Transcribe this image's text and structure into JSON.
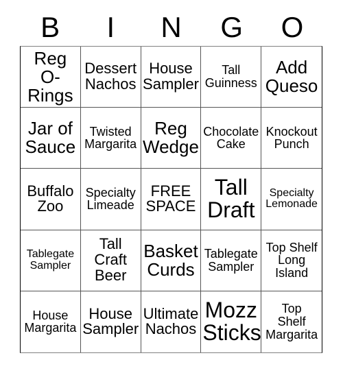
{
  "header": {
    "letters": [
      "B",
      "I",
      "N",
      "G",
      "O"
    ]
  },
  "grid": {
    "rows": 5,
    "columns": 5,
    "cells": [
      {
        "text": "Reg\nO-\nRings",
        "size": "lg"
      },
      {
        "text": "Dessert\nNachos",
        "size": "md"
      },
      {
        "text": "House\nSampler",
        "size": "md"
      },
      {
        "text": "Tall\nGuinness",
        "size": "sm"
      },
      {
        "text": "Add\nQueso",
        "size": "lg"
      },
      {
        "text": "Jar of\nSauce",
        "size": "lg"
      },
      {
        "text": "Twisted\nMargarita",
        "size": "sm"
      },
      {
        "text": "Reg\nWedge",
        "size": "lg"
      },
      {
        "text": "Chocolate\nCake",
        "size": "sm"
      },
      {
        "text": "Knockout\nPunch",
        "size": "sm"
      },
      {
        "text": "Buffalo\nZoo",
        "size": "md"
      },
      {
        "text": "Specialty\nLimeade",
        "size": "sm"
      },
      {
        "text": "FREE\nSPACE",
        "size": "md"
      },
      {
        "text": "Tall\nDraft",
        "size": "xl"
      },
      {
        "text": "Specialty\nLemonade",
        "size": "xs"
      },
      {
        "text": "Tablegate\nSampler",
        "size": "xs"
      },
      {
        "text": "Tall\nCraft\nBeer",
        "size": "md"
      },
      {
        "text": "Basket\nCurds",
        "size": "lg"
      },
      {
        "text": "Tablegate\nSampler",
        "size": "sm"
      },
      {
        "text": "Top Shelf\nLong\nIsland",
        "size": "sm"
      },
      {
        "text": "House\nMargarita",
        "size": "sm"
      },
      {
        "text": "House\nSampler",
        "size": "md"
      },
      {
        "text": "Ultimate\nNachos",
        "size": "md"
      },
      {
        "text": "Mozz\nSticks",
        "size": "xl"
      },
      {
        "text": "Top\nShelf\nMargarita",
        "size": "sm"
      }
    ]
  },
  "colors": {
    "background": "#ffffff",
    "text": "#000000",
    "grid_line": "#555555",
    "grid_outer": "#000000"
  }
}
